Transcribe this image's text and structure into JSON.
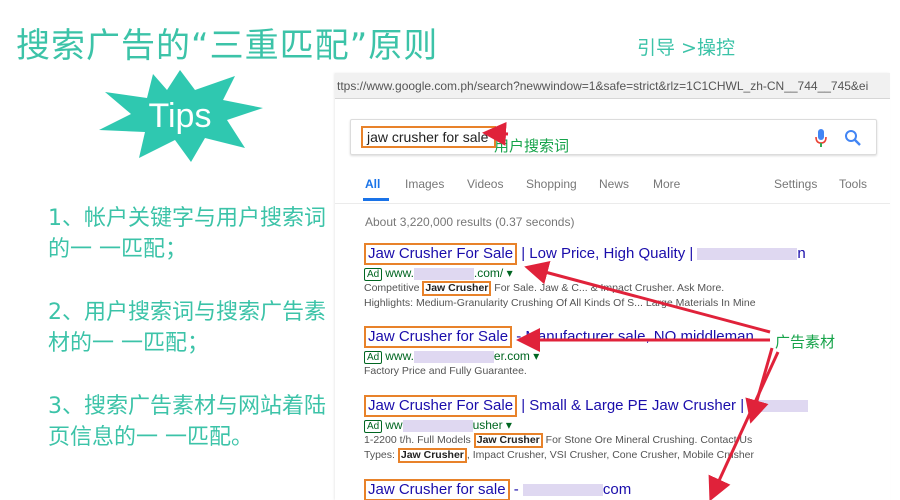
{
  "slide": {
    "title": "搜索广告的“三重匹配”原则",
    "subtitle": "引导 >操控",
    "tips": "Tips",
    "principles": [
      "1、帐户关键字与用户搜索词的一 一匹配；",
      "2、用户搜索词与搜索广告素材的一 一匹配；",
      "3、搜索广告素材与网站着陆页信息的一 一匹配。"
    ],
    "label_search_term": "用户搜索词",
    "label_ad_material": "广告素材"
  },
  "colors": {
    "accent": "#3cc3a8",
    "highlight": "#e8822a",
    "arrow": "#e0223a",
    "link": "#1a0dab"
  },
  "browser": {
    "url": "ttps://www.google.com.ph/search?newwindow=1&safe=strict&rlz=1C1CHWL_zh-CN__744__745&ei",
    "query": "jaw crusher for sale",
    "tabs": [
      "All",
      "Images",
      "Videos",
      "Shopping",
      "News",
      "More",
      "Settings",
      "Tools"
    ],
    "result_stats": "About 3,220,000 results (0.37 seconds)",
    "ad_badge": "Ad",
    "results": [
      {
        "title_kw": "Jaw Crusher For Sale",
        "title_rest": " | Low Price, High Quality | ",
        "title_tail": "n",
        "url_prefix": "www.",
        "url_suffix": ".com/ ▾",
        "desc1_a": "Competitive ",
        "desc1_kw": "Jaw Crusher",
        "desc1_b": " For Sale. Jaw & C... & Impact Crusher. Ask More.",
        "desc2": "Highlights: Medium-Granularity Crushing Of All Kinds Of S... Large Materials In Mine"
      },
      {
        "title_kw": "Jaw Crusher for Sale",
        "title_rest": " - Manufacturer sale, NO middleman",
        "url_prefix": "www.",
        "url_suffix": "er.com ▾",
        "desc1": "Factory Price and Fully Guarantee."
      },
      {
        "title_kw": "Jaw Crusher For Sale",
        "title_rest": " | Small & Large PE Jaw Crusher | ",
        "url_prefix": "ww",
        "url_suffix": "usher ▾",
        "desc1_a": "1-2200 t/h. Full Models ",
        "desc1_kw": "Jaw Crusher",
        "desc1_b": " For Stone Ore Mineral Crushing. Contact Us",
        "desc2_a": "Types: ",
        "desc2_kw": "Jaw Crusher",
        "desc2_b": ", Impact Crusher, VSI Crusher, Cone Crusher, Mobile Crusher"
      },
      {
        "title_kw": "Jaw Crusher for sale",
        "title_rest": " - ",
        "title_tail": "com"
      }
    ]
  }
}
